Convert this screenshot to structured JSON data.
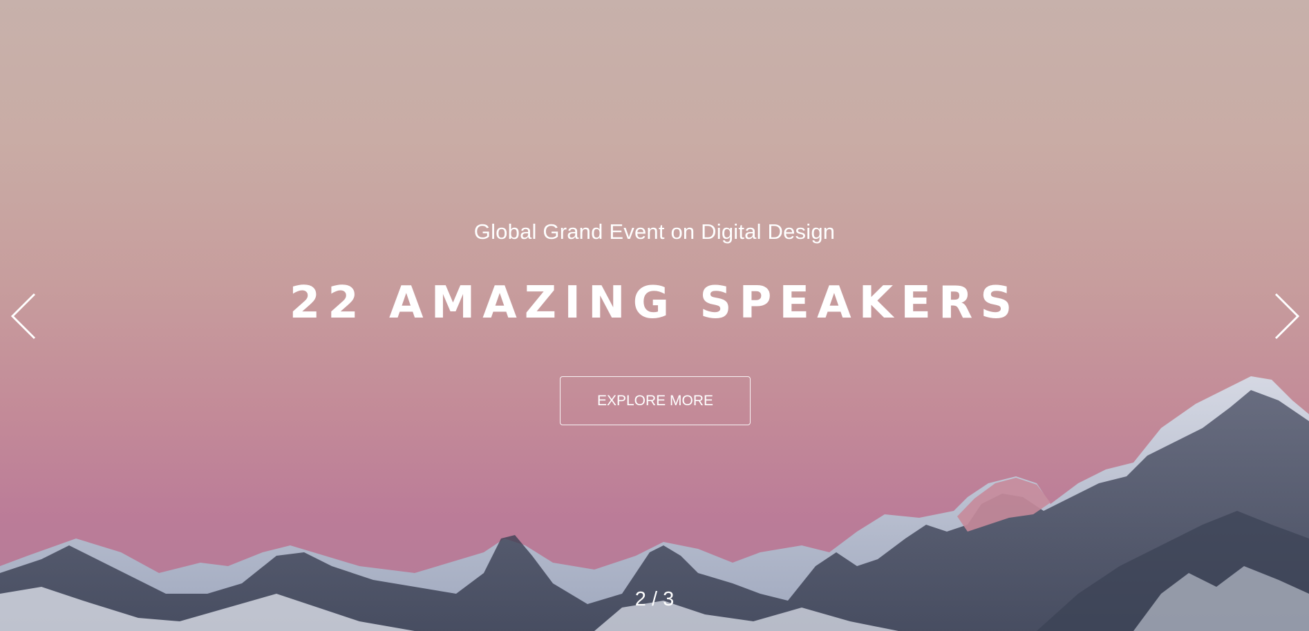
{
  "hero": {
    "subtitle": "Global Grand Event on Digital Design",
    "headline": "22 AMAZING SPEAKERS",
    "cta_label": "EXPLORE MORE"
  },
  "slider": {
    "current": "2",
    "separator": "/",
    "total": "3",
    "prev_icon": "chevron-left-icon",
    "next_icon": "chevron-right-icon"
  },
  "colors": {
    "text": "#ffffff",
    "sky_top": "#c7b1ab",
    "sky_bottom": "#b37c98",
    "mountain_shadow": "#434a60",
    "snow": "#c9cedb"
  }
}
